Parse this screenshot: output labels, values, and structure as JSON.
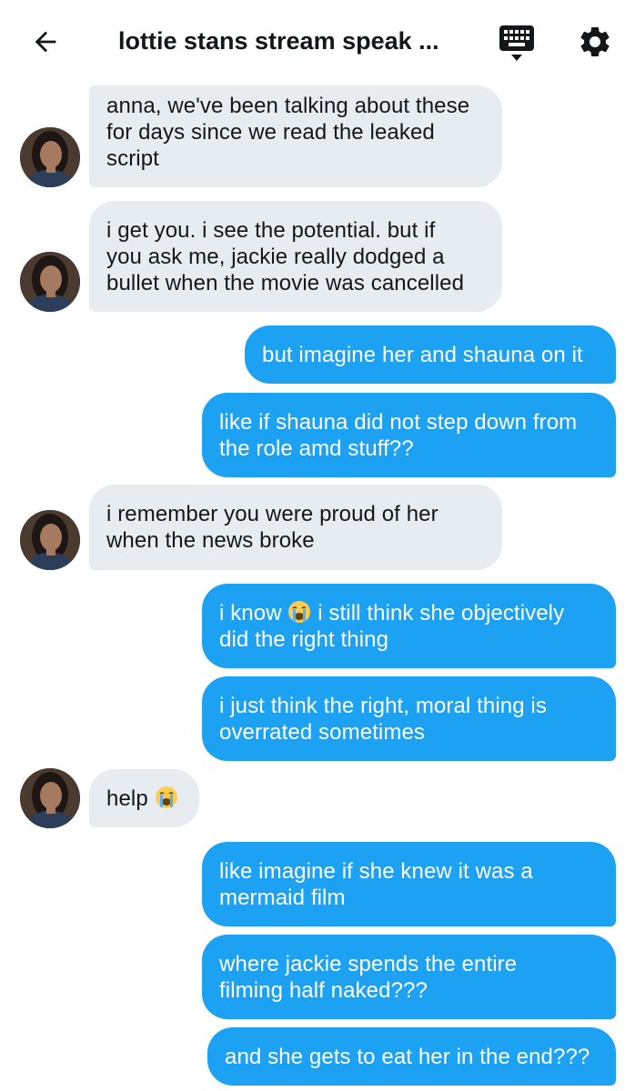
{
  "header": {
    "title": "lottie stans stream speak ...",
    "back_icon": "arrow-left-icon",
    "keyboard_icon": "keyboard-icon",
    "settings_icon": "gear-icon"
  },
  "colors": {
    "outgoing_bubble": "#1da1f2",
    "incoming_bubble": "#e6ecf0",
    "incoming_text": "#14171a",
    "outgoing_text": "#ffffff"
  },
  "messages": [
    {
      "direction": "incoming",
      "lines": [
        "anna, we've been talking about these",
        "for days since we read the leaked",
        "script"
      ]
    },
    {
      "direction": "incoming",
      "lines": [
        "i get you. i see the potential. but if",
        "you ask me, jackie really dodged a",
        "bullet when the movie was cancelled"
      ]
    },
    {
      "direction": "outgoing",
      "lines": [
        "but imagine her and shauna on it"
      ]
    },
    {
      "direction": "outgoing",
      "lines": [
        "like if shauna did not step down from",
        "the role amd stuff??"
      ]
    },
    {
      "direction": "incoming",
      "lines": [
        "i remember you were proud of her",
        "when the news broke"
      ]
    },
    {
      "direction": "outgoing",
      "lines": [
        "i know",
        "i still think she objectively",
        "did the right thing"
      ],
      "emoji": "loudly-crying-face-icon"
    },
    {
      "direction": "outgoing",
      "lines": [
        "i just think the right, moral thing is",
        "overrated sometimes"
      ]
    },
    {
      "direction": "incoming",
      "lines": [
        "help"
      ],
      "emoji": "loudly-crying-face-icon"
    },
    {
      "direction": "outgoing",
      "lines": [
        "like imagine if she knew it was a",
        "mermaid film"
      ]
    },
    {
      "direction": "outgoing",
      "lines": [
        "where jackie spends the entire",
        "filming half naked???"
      ]
    },
    {
      "direction": "outgoing",
      "lines": [
        "and she gets to eat her in the end???"
      ]
    }
  ]
}
